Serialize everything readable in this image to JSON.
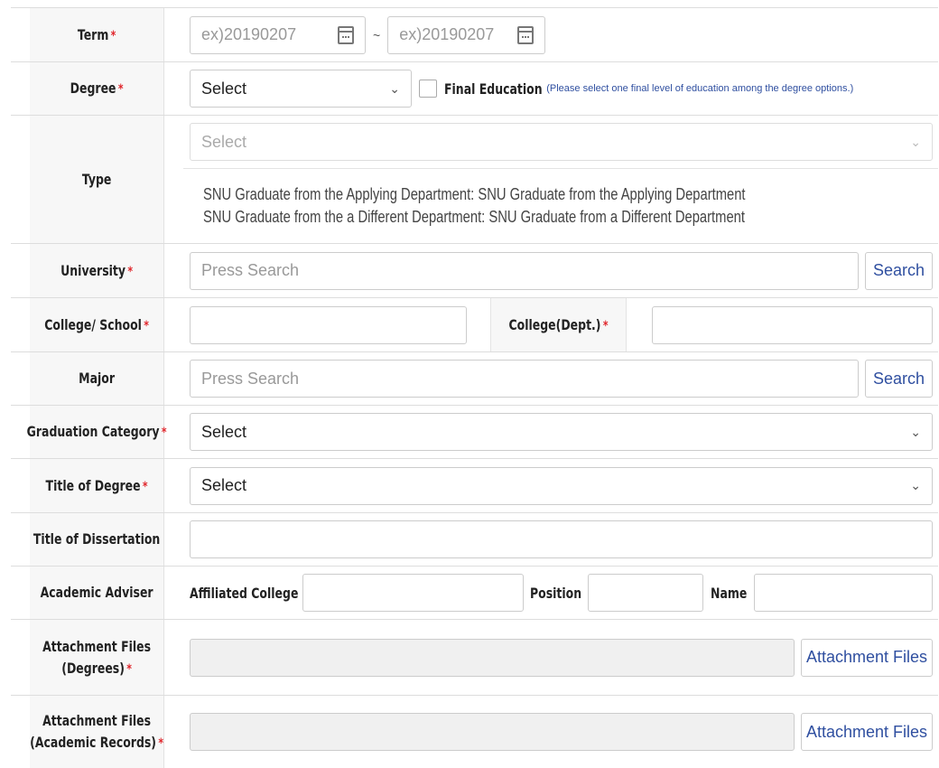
{
  "rows": {
    "term": {
      "label": "Term",
      "required": "*",
      "start_placeholder": "ex)20190207",
      "end_placeholder": "ex)20190207",
      "separator": "~"
    },
    "degree": {
      "label": "Degree",
      "required": "*",
      "select_value": "Select",
      "final_education_label": "Final Education",
      "final_education_note": "(Please select one final level of education among the degree options.)"
    },
    "type": {
      "label": "Type",
      "select_value": "Select",
      "desc_line1": "SNU Graduate from the Applying Department: SNU Graduate from the Applying Department",
      "desc_line2": "SNU Graduate from the a Different Department: SNU Graduate from a Different Department"
    },
    "university": {
      "label": "University",
      "required": "*",
      "placeholder": "Press Search",
      "button": "Search"
    },
    "college_school": {
      "label": "College/ School",
      "required": "*",
      "dept_label": "College(Dept.)",
      "dept_required": "*"
    },
    "major": {
      "label": "Major",
      "placeholder": "Press Search",
      "button": "Search"
    },
    "graduation_category": {
      "label": "Graduation Category",
      "required": "*",
      "select_value": "Select"
    },
    "title_of_degree": {
      "label": "Title of Degree",
      "required": "*",
      "select_value": "Select"
    },
    "title_of_dissertation": {
      "label": "Title of Dissertation"
    },
    "academic_adviser": {
      "label": "Academic Adviser",
      "affiliated_college_label": "Affiliated College",
      "position_label": "Position",
      "name_label": "Name"
    },
    "attachment_degrees": {
      "label_line1": "Attachment Files",
      "label_line2": "(Degrees)",
      "required": "*",
      "button": "Attachment Files"
    },
    "attachment_records": {
      "label_line1": "Attachment Files",
      "label_line2": "(Academic Records)",
      "required": "*",
      "button": "Attachment Files"
    }
  },
  "icons": {
    "calendar": "calendar-icon",
    "chevron": "chevron-down-icon"
  },
  "colors": {
    "required": "#e0262c",
    "link_blue": "#2f4fa0",
    "label_bg": "#f7f7f7"
  }
}
